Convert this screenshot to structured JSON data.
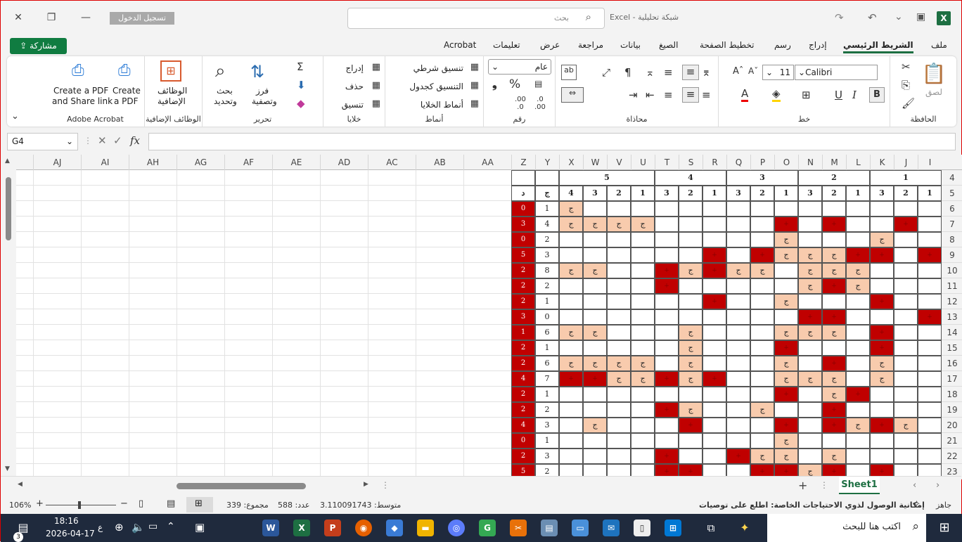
{
  "title_bar": {
    "app": "Excel",
    "file": "شبكة تحليلية",
    "separator": "-",
    "search_placeholder": "بحث",
    "sign_in": "تسجيل الدخول",
    "close": "✕",
    "restore": "❐",
    "minimize": "—"
  },
  "tabs": [
    {
      "label": "ملف",
      "active": false
    },
    {
      "label": "الشريط الرئيسي",
      "active": true
    },
    {
      "label": "إدراج",
      "active": false
    },
    {
      "label": "رسم",
      "active": false
    },
    {
      "label": "تخطيط الصفحة",
      "active": false
    },
    {
      "label": "الصيغ",
      "active": false
    },
    {
      "label": "بيانات",
      "active": false
    },
    {
      "label": "مراجعة",
      "active": false
    },
    {
      "label": "عرض",
      "active": false
    },
    {
      "label": "تعليمات",
      "active": false
    },
    {
      "label": "Acrobat",
      "active": false
    }
  ],
  "share_button": "مشاركة",
  "ribbon": {
    "clipboard": {
      "label": "الحافظة",
      "paste": "لصق"
    },
    "font": {
      "label": "خط",
      "font_name": "Calibri",
      "font_size": "11"
    },
    "alignment": {
      "label": "محاذاة"
    },
    "number": {
      "label": "رقم",
      "format": "عام"
    },
    "styles": {
      "label": "أنماط",
      "conditional": "تنسيق شرطي",
      "as_table": "التنسيق كجدول",
      "cell_styles": "أنماط الخلايا"
    },
    "cells": {
      "label": "خلايا",
      "insert": "إدراج",
      "delete": "حذف",
      "format": "تنسيق"
    },
    "editing": {
      "label": "تحرير",
      "sort_filter_1": "فرز",
      "sort_filter_2": "وتصفية",
      "find_1": "بحث",
      "find_2": "وتحديد"
    },
    "addins": {
      "label": "الوظائف الإضافية",
      "btn_1": "الوظائف",
      "btn_2": "الإضافية"
    },
    "acrobat": {
      "label": "Adobe Acrobat",
      "create_pdf_1": "Create",
      "create_pdf_2": "a PDF",
      "share_1": "Create a PDF",
      "share_2": "and Share link"
    }
  },
  "formula_bar": {
    "name_box": "G4",
    "fx": "fx",
    "value": ""
  },
  "columns_left": [
    "AJ",
    "AI",
    "AH",
    "AG",
    "AF",
    "AE",
    "AD",
    "AC",
    "AB",
    "AA"
  ],
  "columns_right": [
    "Z",
    "Y",
    "X",
    "W",
    "V",
    "U",
    "T",
    "S",
    "R",
    "Q",
    "P",
    "O",
    "N",
    "M",
    "L",
    "K",
    "J",
    "I"
  ],
  "rows": [
    "4",
    "5",
    "6",
    "7",
    "8",
    "9",
    "10",
    "11",
    "12",
    "13",
    "14",
    "15",
    "16",
    "17",
    "18",
    "19",
    "20",
    "21",
    "22",
    "23"
  ],
  "groups_row4": [
    {
      "label": "5"
    },
    {
      "label": "4"
    },
    {
      "label": "3"
    },
    {
      "label": "2"
    },
    {
      "label": "1"
    }
  ],
  "row5": [
    "د",
    "ج",
    "4",
    "3",
    "2",
    "1",
    "3",
    "2",
    "1",
    "3",
    "2",
    "1",
    "3",
    "2",
    "1",
    "3",
    "2",
    "1"
  ],
  "cells_by_row": {
    "6": [
      "R0",
      "1",
      "P",
      "",
      "",
      "",
      "",
      "",
      "",
      "",
      "",
      "",
      "",
      "",
      "",
      "",
      "",
      ""
    ],
    "7": [
      "R3",
      "4",
      "P",
      "P",
      "P",
      "P",
      "",
      "",
      "",
      "",
      "",
      "R",
      "",
      "R",
      "",
      "",
      "R",
      ""
    ],
    "8": [
      "R0",
      "2",
      "",
      "",
      "",
      "",
      "",
      "",
      "",
      "",
      "",
      "P",
      "",
      "",
      "",
      "P",
      "",
      ""
    ],
    "9": [
      "R5",
      "3",
      "",
      "",
      "",
      "",
      "",
      "",
      "R",
      "",
      "R",
      "P",
      "P",
      "P",
      "R",
      "R",
      "",
      "R"
    ],
    "10": [
      "R2",
      "8",
      "P",
      "P",
      "",
      "",
      "R",
      "P",
      "R",
      "P",
      "P",
      "",
      "P",
      "P",
      "P",
      "",
      "",
      ""
    ],
    "11": [
      "R2",
      "2",
      "",
      "",
      "",
      "",
      "R",
      "",
      "",
      "",
      "",
      "",
      "P",
      "R",
      "P",
      "",
      "",
      ""
    ],
    "12": [
      "R2",
      "1",
      "",
      "",
      "",
      "",
      "",
      "",
      "R",
      "",
      "",
      "P",
      "",
      "",
      "",
      "R",
      "",
      ""
    ],
    "13": [
      "R3",
      "0",
      "",
      "",
      "",
      "",
      "",
      "",
      "",
      "",
      "",
      "",
      "R",
      "R",
      "",
      "",
      "",
      "R"
    ],
    "14": [
      "R1",
      "6",
      "P",
      "P",
      "",
      "",
      "",
      "P",
      "",
      "",
      "",
      "P",
      "P",
      "P",
      "",
      "R",
      "",
      ""
    ],
    "15": [
      "R2",
      "1",
      "",
      "",
      "",
      "",
      "",
      "P",
      "",
      "",
      "",
      "R",
      "",
      "",
      "",
      "R",
      "",
      ""
    ],
    "16": [
      "R2",
      "6",
      "P",
      "P",
      "P",
      "P",
      "",
      "P",
      "",
      "",
      "",
      "P",
      "",
      "R",
      "",
      "P",
      "",
      ""
    ],
    "17": [
      "R4",
      "7",
      "R",
      "R",
      "P",
      "P",
      "R",
      "P",
      "R",
      "",
      "",
      "P",
      "P",
      "P",
      "",
      "P",
      "",
      ""
    ],
    "18": [
      "R2",
      "1",
      "",
      "",
      "",
      "",
      "",
      "",
      "",
      "",
      "",
      "R",
      "",
      "P",
      "R",
      "",
      "",
      ""
    ],
    "19": [
      "R2",
      "2",
      "",
      "",
      "",
      "",
      "R",
      "P",
      "",
      "",
      "P",
      "",
      "",
      "R",
      "",
      "",
      "",
      ""
    ],
    "20": [
      "R4",
      "3",
      "",
      "P",
      "",
      "",
      "",
      "R",
      "",
      "",
      "",
      "R",
      "",
      "R",
      "P",
      "R",
      "P",
      ""
    ],
    "21": [
      "R0",
      "1",
      "",
      "",
      "",
      "",
      "",
      "",
      "",
      "",
      "",
      "P",
      "",
      "",
      "",
      "",
      "",
      ""
    ],
    "22": [
      "R2",
      "3",
      "",
      "",
      "",
      "",
      "R",
      "",
      "",
      "R",
      "P",
      "P",
      "",
      "P",
      "",
      "",
      "",
      ""
    ],
    "23": [
      "R5",
      "2",
      "",
      "",
      "",
      "",
      "R",
      "R",
      "",
      "",
      "R",
      "R",
      "P",
      "R",
      "",
      "R",
      "",
      ""
    ]
  },
  "pink_mark": "ج",
  "red_mark": "+",
  "sheet_tab": "Sheet1",
  "add_sheet": "+",
  "status": {
    "ready": "جاهز",
    "accessibility": "إمكانية الوصول لذوي الاحتياجات الخاصة: اطلع على توصيات",
    "average": "متوسط: 3.110091743",
    "count": "عدد: 588",
    "sum": "مجموع: 339",
    "zoom": "106%"
  },
  "taskbar": {
    "search": "اكتب هنا للبحث",
    "time": "18:16",
    "date": "2026-04-17",
    "lang": "ع",
    "notif": "3"
  },
  "colors": {
    "excel_green": "#1d6f42",
    "red_cell": "#c00000",
    "pink_cell": "#f8cbad"
  }
}
